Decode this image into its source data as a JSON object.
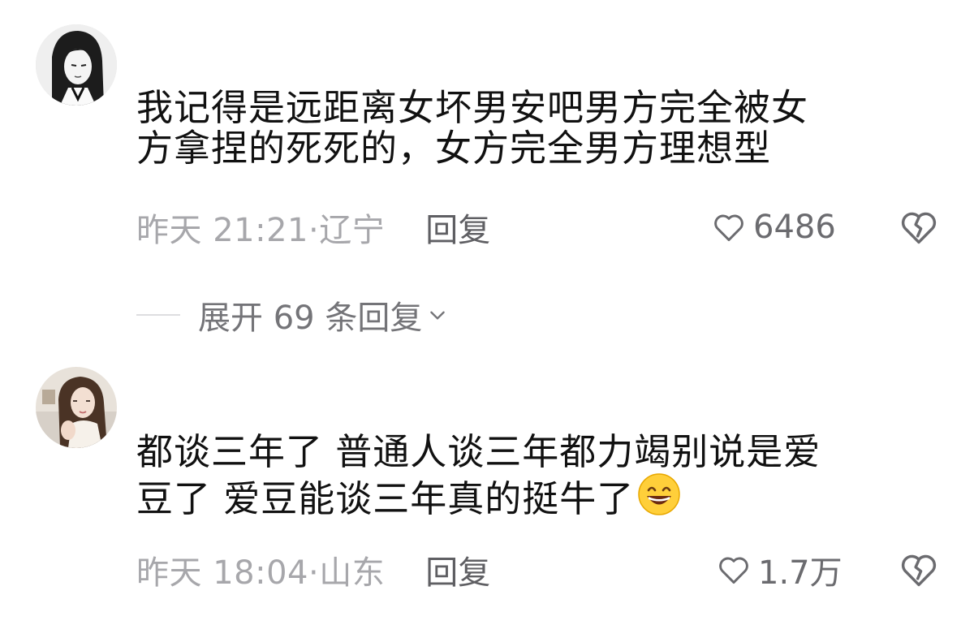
{
  "comments": [
    {
      "avatar_icon": "avatar-monochrome-woman",
      "text": "我记得是远距离女坏男安吧男方完全被女\n方拿捏的死死的，女方完全男方理想型",
      "time_location": "昨天 21:21·辽宁",
      "reply_label": "回复",
      "likes": "6486",
      "like_icon": "heart-outline-icon",
      "dislike_icon": "broken-heart-icon",
      "replies_toggle": "展开 69 条回复"
    },
    {
      "avatar_icon": "avatar-photo-girl",
      "text": "都谈三年了 普通人谈三年都力竭别说是爱\n豆了 爱豆能谈三年真的挺牛了",
      "emoji": "grinning-face-emoji",
      "time_location": "昨天 18:04·山东",
      "reply_label": "回复",
      "likes": "1.7万",
      "like_icon": "heart-outline-icon",
      "dislike_icon": "broken-heart-icon"
    }
  ],
  "colors": {
    "text_primary": "#111111",
    "text_meta": "#a7a7ab",
    "text_reply": "#5f5f63",
    "icon_gray": "#6b6b6f"
  }
}
